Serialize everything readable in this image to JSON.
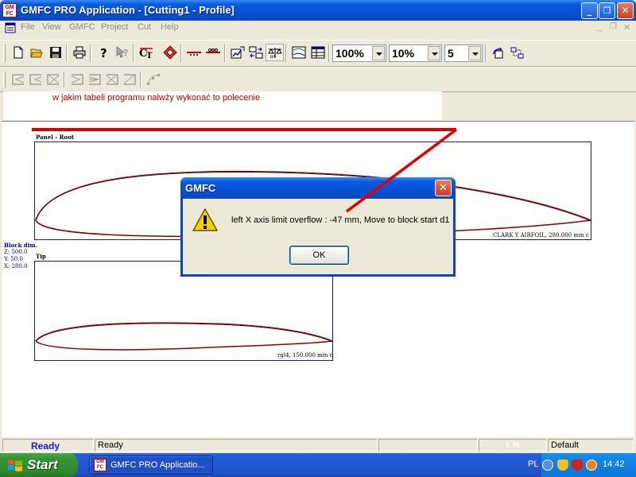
{
  "window": {
    "title": "GMFC PRO Application - [Cutting1 - Profile]",
    "icon_top": "GM",
    "icon_bottom": "FC",
    "minimize": "_",
    "restore": "❐",
    "close": "✕"
  },
  "menu": {
    "items": [
      "File",
      "View",
      "GMFC",
      "Project",
      "Cut",
      "Help"
    ],
    "mdi_minimize": "_",
    "mdi_restore": "❐",
    "mdi_close": "✕"
  },
  "toolbar": {
    "zoom": "100%",
    "step": "10%",
    "count": "5"
  },
  "note": {
    "text": "w jakim tabeli programu nalwży wykonać to polecenie",
    "color": "#c00000"
  },
  "panels": {
    "root_label": "Panel - Root",
    "root_caption": "CLARK Y AIRFOIL, 280.000 mm c",
    "tip_label": "Tip",
    "tip_caption": "rgl4, 150.000 mm c"
  },
  "block_dim": {
    "title": "Block dim.",
    "z": "Z: 500.0",
    "y": "Y: 50.0",
    "x": "X: 280.0"
  },
  "dialog": {
    "title": "GMFC",
    "close": "✕",
    "message": "left X axis limit overflow : -47 mm, Move to block start d1",
    "ok": "OK"
  },
  "status": {
    "ready_main": "Ready",
    "ready": "Ready",
    "progress": "0 %",
    "mode": "Default"
  },
  "taskbar": {
    "start": "Start",
    "task": "GMFC PRO Applicatio...",
    "task_icon_top": "GM",
    "task_icon_bottom": "FC",
    "lang": "PL",
    "time": "14:42"
  },
  "colors": {
    "annotation_red": "#e00000",
    "airfoil_red": "#8b0000",
    "panel_border": "#1a1aa0"
  }
}
